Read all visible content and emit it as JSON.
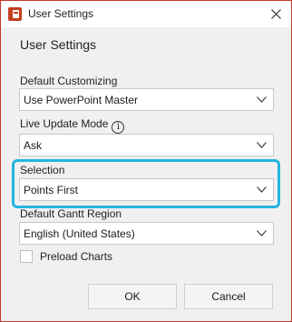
{
  "window": {
    "title": "User Settings",
    "close_symbol": "✕"
  },
  "heading": "User Settings",
  "fields": {
    "default_customizing": {
      "label": "Default Customizing",
      "value": "Use PowerPoint Master"
    },
    "live_update_mode": {
      "label": "Live Update Mode",
      "info_symbol": "i",
      "value": "Ask"
    },
    "selection": {
      "label": "Selection",
      "value": "Points First"
    },
    "default_gantt_region": {
      "label": "Default Gantt Region",
      "value": "English (United States)"
    }
  },
  "preload_charts": {
    "label": "Preload Charts",
    "checked": false
  },
  "buttons": {
    "ok": "OK",
    "cancel": "Cancel"
  },
  "colors": {
    "highlight": "#24b5e0",
    "app_icon": "#c43e1c",
    "window_border": "#c0392b"
  },
  "icons": {
    "app": "powerpoint-icon",
    "close": "close-icon",
    "info": "info-icon",
    "dropdown": "chevron-down-icon"
  }
}
